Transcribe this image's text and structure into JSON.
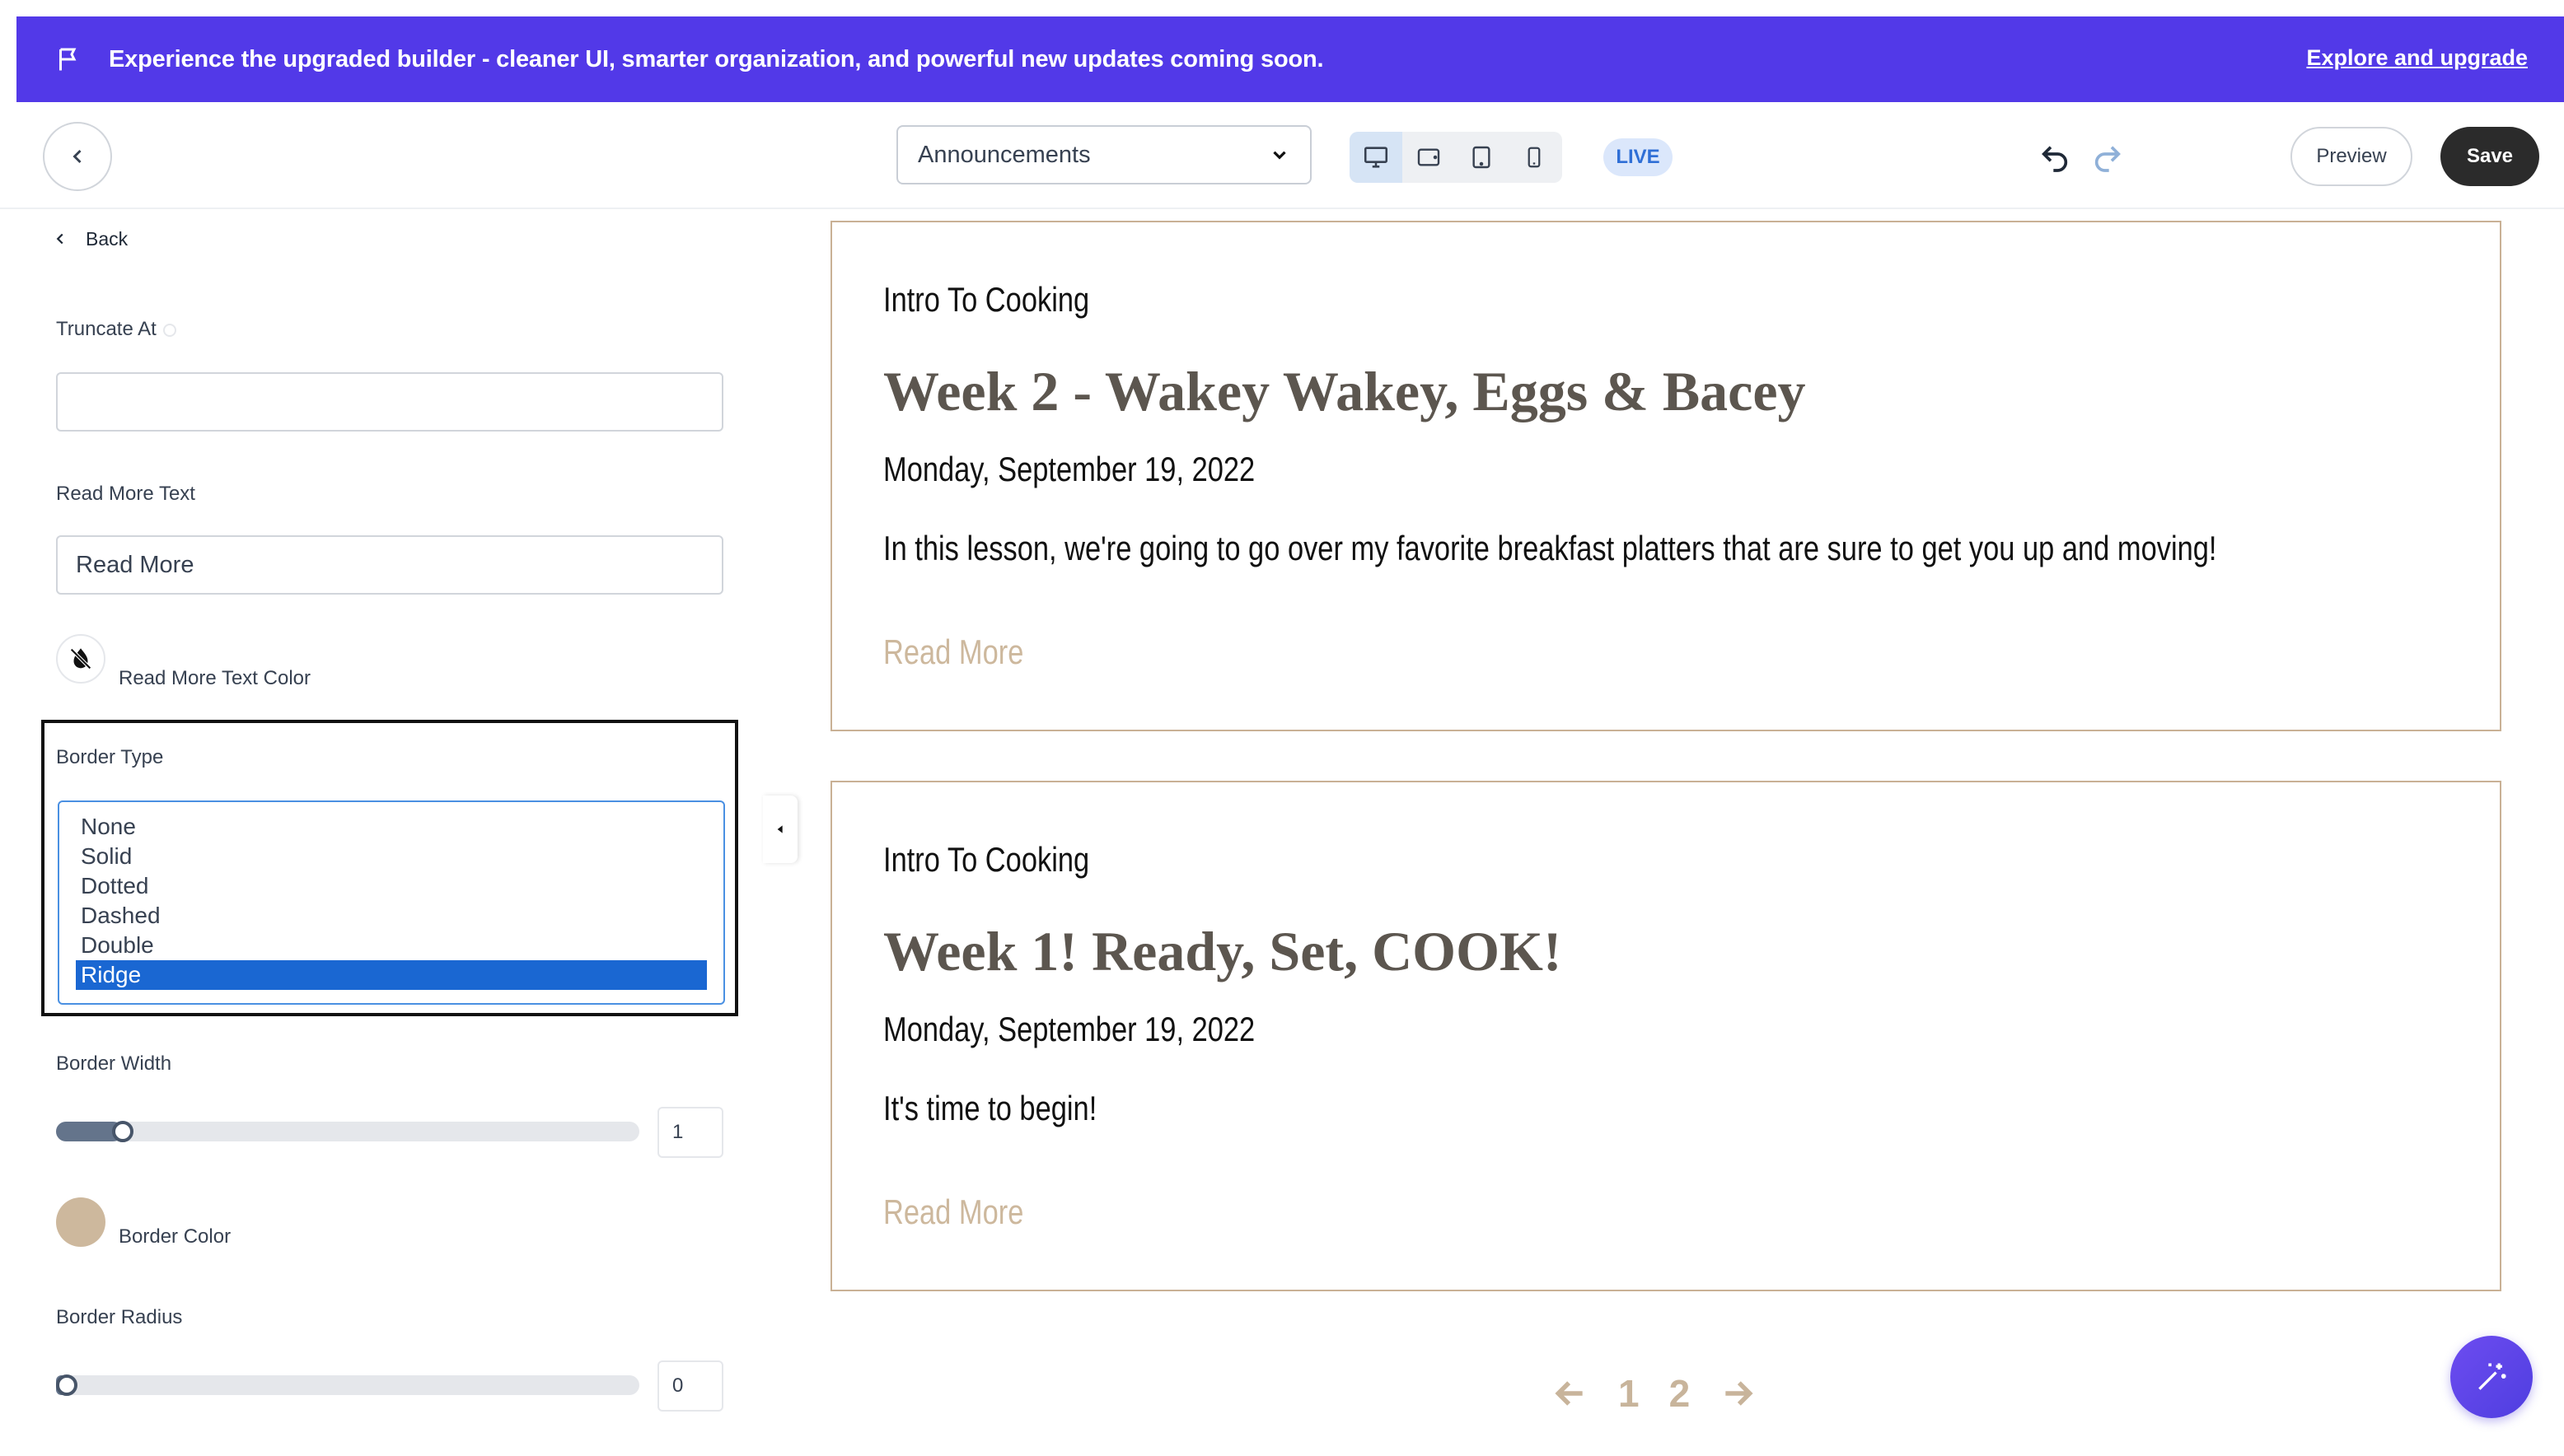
{
  "banner": {
    "message": "Experience the upgraded builder - cleaner UI, smarter organization, and powerful new updates coming soon.",
    "link": "Explore and upgrade",
    "color": "#5239e8"
  },
  "toolbar": {
    "page_select": "Announcements",
    "status_badge": "LIVE",
    "preview_label": "Preview",
    "save_label": "Save",
    "devices": [
      "desktop-icon",
      "tablet-landscape-icon",
      "tablet-icon",
      "mobile-icon"
    ]
  },
  "panel": {
    "back_label": "Back",
    "truncate_label": "Truncate At",
    "truncate_value": "",
    "read_more_label": "Read More Text",
    "read_more_value": "Read More",
    "read_more_color_label": "Read More Text Color",
    "border_type_label": "Border Type",
    "border_type_options": [
      "None",
      "Solid",
      "Dotted",
      "Dashed",
      "Double",
      "Ridge"
    ],
    "border_type_selected": "Ridge",
    "border_width_label": "Border Width",
    "border_width_value": "1",
    "border_width_fraction": 0.1,
    "border_color_label": "Border Color",
    "border_color": "#cdb89d",
    "border_radius_label": "Border Radius",
    "border_radius_value": "0",
    "border_radius_fraction": 0
  },
  "posts": [
    {
      "course": "Intro To Cooking",
      "title": "Week 2 - Wakey Wakey, Eggs & Bacey",
      "date": "Monday, September 19, 2022",
      "description": "In this lesson, we're going to go over my favorite breakfast platters that are sure to get you up and moving!",
      "read_more": "Read More"
    },
    {
      "course": "Intro To Cooking",
      "title": "Week 1! Ready, Set, COOK!",
      "date": "Monday, September 19, 2022",
      "description": "It's time to begin!",
      "read_more": "Read More"
    }
  ],
  "pagination": {
    "pages": [
      "1",
      "2"
    ]
  }
}
